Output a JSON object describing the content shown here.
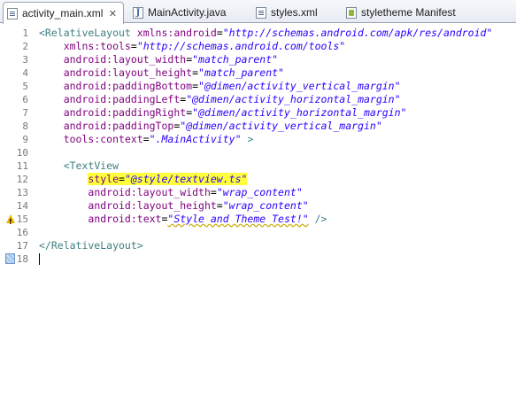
{
  "tabs": [
    {
      "label": "activity_main.xml",
      "icon": "xml-file-icon",
      "active": true,
      "close": "✕"
    },
    {
      "label": "MainActivity.java",
      "icon": "java-file-icon",
      "active": false
    },
    {
      "label": "styles.xml",
      "icon": "xml-file-icon",
      "active": false
    },
    {
      "label": "styletheme Manifest",
      "icon": "manifest-file-icon",
      "active": false
    }
  ],
  "editor": {
    "lines": [
      {
        "n": "1",
        "segments": [
          [
            "tag",
            "<RelativeLayout "
          ],
          [
            "attr",
            "xmlns:android"
          ],
          [
            "eq",
            "="
          ],
          [
            "val",
            "\"http://schemas.android.com/apk/res/android\""
          ]
        ]
      },
      {
        "n": "2",
        "segments": [
          [
            "sp",
            "    "
          ],
          [
            "attr",
            "xmlns:tools"
          ],
          [
            "eq",
            "="
          ],
          [
            "val",
            "\"http://schemas.android.com/tools\""
          ]
        ]
      },
      {
        "n": "3",
        "segments": [
          [
            "sp",
            "    "
          ],
          [
            "attr",
            "android:layout_width"
          ],
          [
            "eq",
            "="
          ],
          [
            "val",
            "\"match_parent\""
          ]
        ]
      },
      {
        "n": "4",
        "segments": [
          [
            "sp",
            "    "
          ],
          [
            "attr",
            "android:layout_height"
          ],
          [
            "eq",
            "="
          ],
          [
            "val",
            "\"match_parent\""
          ]
        ]
      },
      {
        "n": "5",
        "segments": [
          [
            "sp",
            "    "
          ],
          [
            "attr",
            "android:paddingBottom"
          ],
          [
            "eq",
            "="
          ],
          [
            "val",
            "\"@dimen/activity_vertical_margin\""
          ]
        ]
      },
      {
        "n": "6",
        "segments": [
          [
            "sp",
            "    "
          ],
          [
            "attr",
            "android:paddingLeft"
          ],
          [
            "eq",
            "="
          ],
          [
            "val",
            "\"@dimen/activity_horizontal_margin\""
          ]
        ]
      },
      {
        "n": "7",
        "segments": [
          [
            "sp",
            "    "
          ],
          [
            "attr",
            "android:paddingRight"
          ],
          [
            "eq",
            "="
          ],
          [
            "val",
            "\"@dimen/activity_horizontal_margin\""
          ]
        ]
      },
      {
        "n": "8",
        "segments": [
          [
            "sp",
            "    "
          ],
          [
            "attr",
            "android:paddingTop"
          ],
          [
            "eq",
            "="
          ],
          [
            "val",
            "\"@dimen/activity_vertical_margin\""
          ]
        ]
      },
      {
        "n": "9",
        "segments": [
          [
            "sp",
            "    "
          ],
          [
            "attr",
            "tools:context"
          ],
          [
            "eq",
            "="
          ],
          [
            "val",
            "\".MainActivity\""
          ],
          [
            "tag",
            " >"
          ]
        ]
      },
      {
        "n": "10",
        "segments": []
      },
      {
        "n": "11",
        "segments": [
          [
            "sp",
            "    "
          ],
          [
            "tag",
            "<TextView"
          ]
        ]
      },
      {
        "n": "12",
        "segments": [
          [
            "sp",
            "        "
          ],
          [
            "hlattr",
            "style"
          ],
          [
            "hleq",
            "="
          ],
          [
            "hlval",
            "\"@style/textview.ts\""
          ]
        ]
      },
      {
        "n": "13",
        "segments": [
          [
            "sp",
            "        "
          ],
          [
            "attr",
            "android:layout_width"
          ],
          [
            "eq",
            "="
          ],
          [
            "val",
            "\"wrap_content\""
          ]
        ]
      },
      {
        "n": "14",
        "segments": [
          [
            "sp",
            "        "
          ],
          [
            "attr",
            "android:layout_height"
          ],
          [
            "eq",
            "="
          ],
          [
            "val",
            "\"wrap_content\""
          ]
        ]
      },
      {
        "n": "15",
        "segments": [
          [
            "sp",
            "        "
          ],
          [
            "attr",
            "android:text"
          ],
          [
            "eq",
            "="
          ],
          [
            "warnval",
            "\"Style and Theme Test!\""
          ],
          [
            "tag",
            " />"
          ]
        ],
        "warning": true
      },
      {
        "n": "16",
        "segments": []
      },
      {
        "n": "17",
        "segments": [
          [
            "tag",
            "</RelativeLayout>"
          ]
        ]
      },
      {
        "n": "18",
        "segments": [],
        "current": true
      }
    ]
  },
  "colors": {
    "tag": "#3f7f7f",
    "attribute": "#7f007f",
    "value": "#2a00ff",
    "highlight": "#ffff3a"
  }
}
